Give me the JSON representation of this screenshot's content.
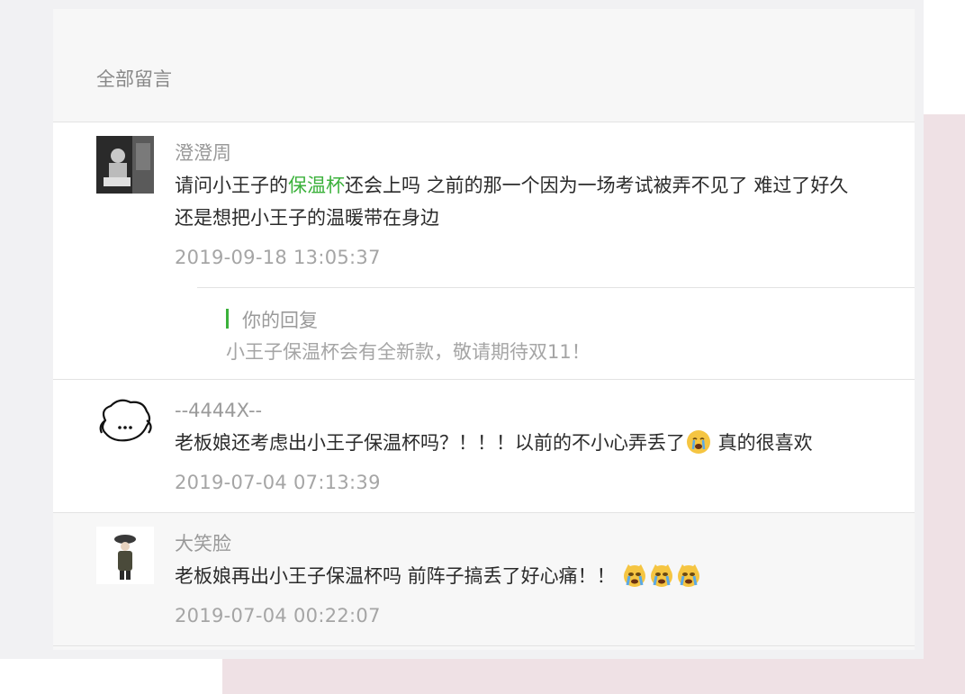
{
  "panel": {
    "title": "全部留言"
  },
  "comments": [
    {
      "nickname": "澄澄周",
      "content_before": "请问小王子的",
      "content_highlight": "保温杯",
      "content_after": "还会上吗 之前的那一个因为一场考试被弄不见了 难过了好久",
      "content_line2": "还是想把小王子的温暖带在身边",
      "timestamp": "2019-09-18 13:05:37",
      "reply": {
        "label": "你的回复",
        "text": "小王子保温杯会有全新款，敬请期待双11！"
      }
    },
    {
      "nickname": "--4444X--",
      "content_before": "老板娘还考虑出小王子保温杯吗？！！！以前的不小心弄丢了",
      "content_after": " 真的很喜欢",
      "emoji": [
        "crying-face"
      ],
      "timestamp": "2019-07-04 07:13:39"
    },
    {
      "nickname": "大笑脸",
      "content": "老板娘再出小王子保温杯吗 前阵子搞丢了好心痛！！",
      "emoji": [
        "crying-cat",
        "crying-cat",
        "crying-cat"
      ],
      "timestamp": "2019-07-04 00:22:07"
    }
  ],
  "colors": {
    "highlight": "#3bb13b",
    "reply_bar": "#3bb13b",
    "pink_bg": "#efe1e5"
  }
}
